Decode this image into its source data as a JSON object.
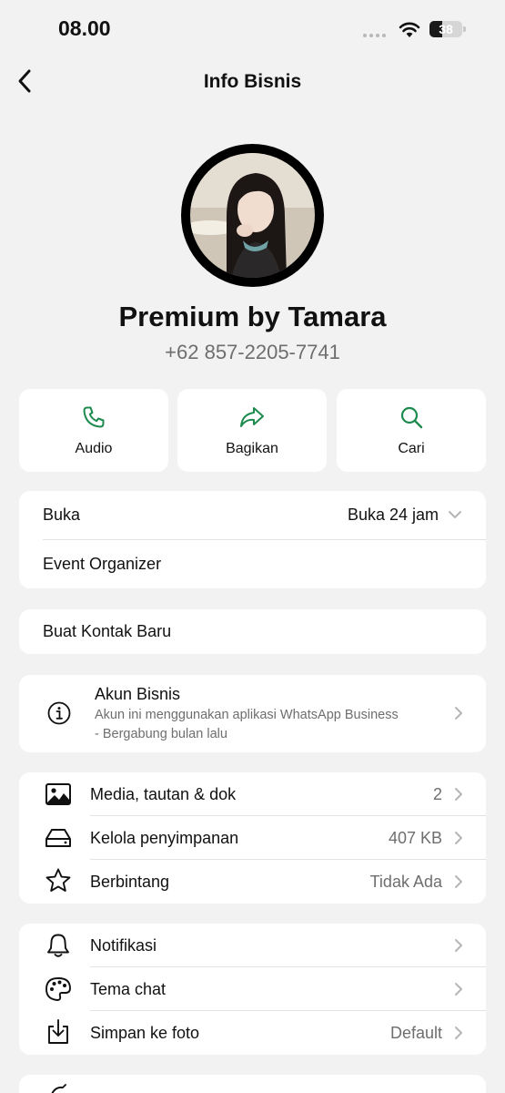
{
  "status_bar": {
    "time": "08.00",
    "battery": "38",
    "battery_level": 0.38
  },
  "header": {
    "title": "Info Bisnis"
  },
  "profile": {
    "name": "Premium by Tamara",
    "phone": "+62 857-2205-7741"
  },
  "actions": [
    {
      "label": "Audio",
      "icon": "phone-icon"
    },
    {
      "label": "Bagikan",
      "icon": "share-icon"
    },
    {
      "label": "Cari",
      "icon": "search-icon"
    }
  ],
  "hours": {
    "label": "Buka",
    "value": "Buka 24 jam",
    "category": "Event Organizer"
  },
  "new_contact": {
    "label": "Buat Kontak Baru"
  },
  "business": {
    "title": "Akun Bisnis",
    "desc_line1": "Akun ini menggunakan aplikasi WhatsApp Business",
    "desc_line2": "- Bergabung bulan lalu"
  },
  "media_section": [
    {
      "label": "Media, tautan & dok",
      "value": "2",
      "icon": "image-icon"
    },
    {
      "label": "Kelola penyimpanan",
      "value": "407 KB",
      "icon": "storage-icon"
    },
    {
      "label": "Berbintang",
      "value": "Tidak Ada",
      "icon": "star-icon"
    }
  ],
  "settings_section": [
    {
      "label": "Notifikasi",
      "value": "",
      "icon": "bell-icon"
    },
    {
      "label": "Tema chat",
      "value": "",
      "icon": "palette-icon"
    },
    {
      "label": "Simpan ke foto",
      "value": "Default",
      "icon": "download-icon"
    }
  ],
  "colors": {
    "accent": "#1d8a4e",
    "background": "#f2f2f2",
    "card": "#ffffff",
    "secondary_text": "#6e6e6e"
  }
}
